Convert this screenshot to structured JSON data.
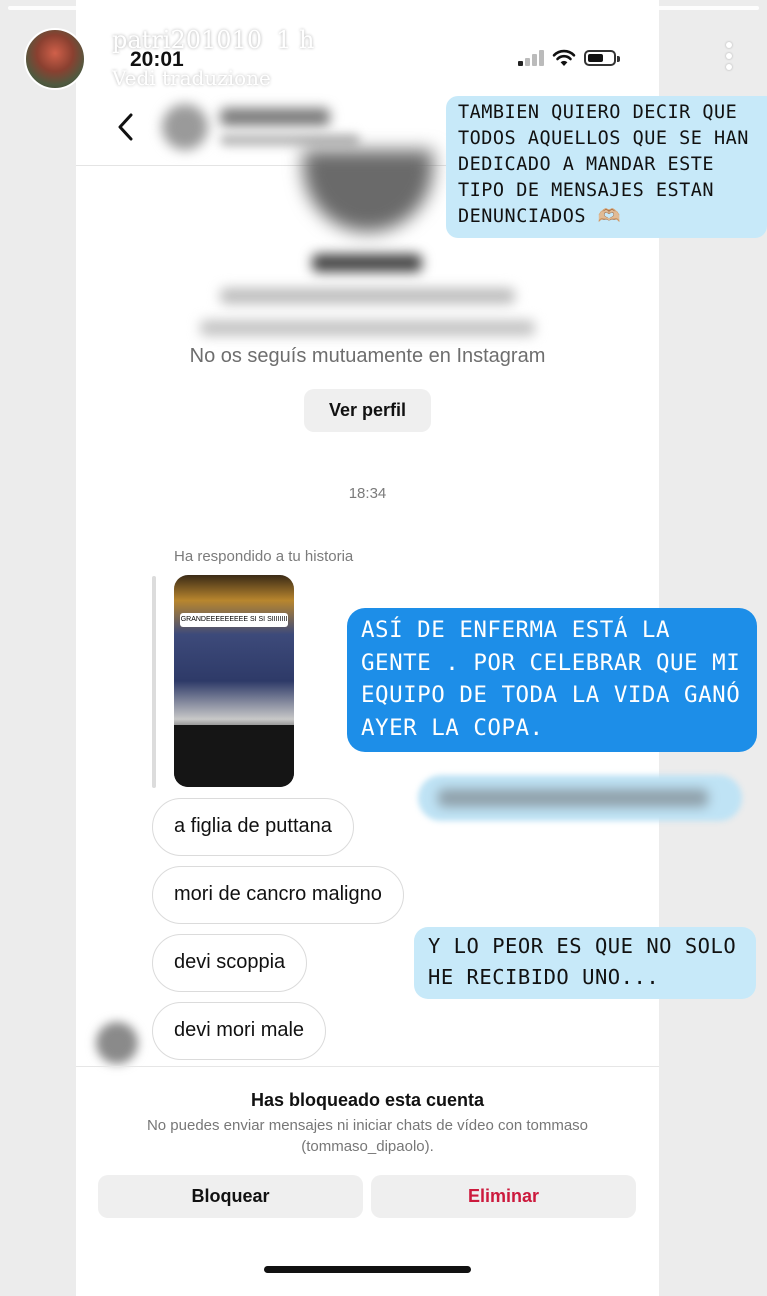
{
  "story": {
    "username": "patri201010",
    "time_ago": "1 h",
    "see_translation": "Vedi traduzione",
    "progress_segments": 6
  },
  "status_bar": {
    "time": "20:01",
    "battery_level": 0.62
  },
  "profile": {
    "mutual_text": "No os seguís mutuamente en Instagram",
    "view_profile_button": "Ver perfil"
  },
  "chat": {
    "timestamp": "18:34",
    "replied_to_story": "Ha respondido a tu historia",
    "story_caption": "GRANDEEEEEEEEE SI SI SIIIIIIII",
    "messages": [
      "a figlia de puttana",
      "mori de cancro maligno",
      "devi scoppia",
      "devi mori male"
    ]
  },
  "overlays": {
    "top_note": [
      "TAMBIEN QUIERO DECIR QUE",
      "TODOS AQUELLOS QUE SE HAN",
      "DEDICADO A MANDAR ESTE",
      "TIPO DE MENSAJES ESTAN",
      "DENUNCIADOS 🫶🏼"
    ],
    "middle_note": [
      "ASÍ DE ENFERMA ESTÁ LA",
      "GENTE . POR CELEBRAR QUE MI",
      "EQUIPO DE TODA LA VIDA GANÓ",
      "AYER LA COPA."
    ],
    "bottom_note": [
      "Y LO PEOR ES QUE NO SOLO",
      "HE RECIBIDO UNO..."
    ]
  },
  "blocked": {
    "title": "Has bloqueado esta cuenta",
    "description": "No puedes enviar mensajes ni iniciar chats de vídeo con tommaso (tommaso_dipaolo).",
    "block_button": "Bloquear",
    "delete_button": "Eliminar"
  },
  "colors": {
    "overlay_light": "#c7e9f9",
    "overlay_dark": "#1d8ee8",
    "delete_red": "#cc1a3d"
  }
}
